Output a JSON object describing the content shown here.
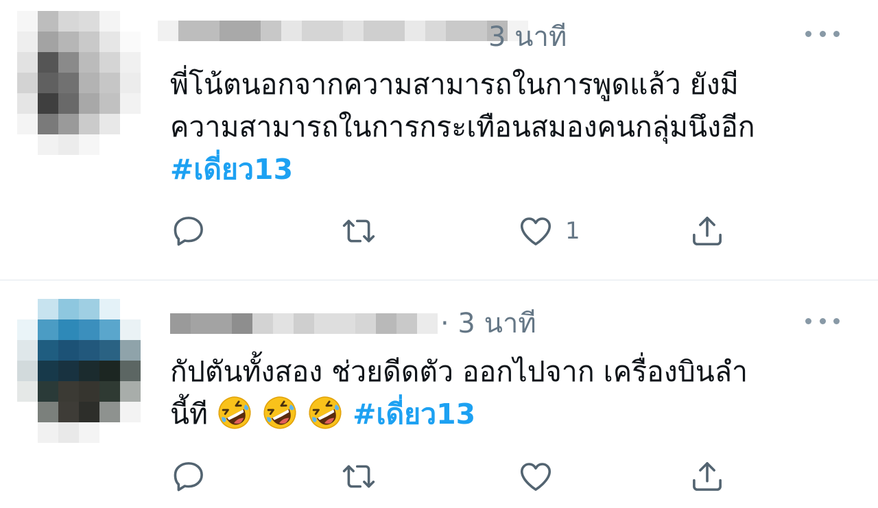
{
  "tweets": [
    {
      "time": "3 นาที",
      "lines": [
        "พี่โน้ตนอกจากความสามารถในการพูดแล้ว ยังมี",
        "ความสามารถในการกระเทือนสมองคนกลุ่มนึงอีก"
      ],
      "hashtag": "#เดี่ยว13",
      "emoji_count": 0,
      "like_count": "1"
    },
    {
      "time": "· 3 นาที",
      "lines": [
        "กัปตันทั้งสอง ช่วยดีดตัว ออกไปจาก เครื่องบินลำ",
        "นี้ที"
      ],
      "hashtag": "#เดี่ยว13",
      "emoji_count": 3,
      "like_count": ""
    }
  ],
  "icons": {
    "reply": "reply-icon",
    "retweet": "retweet-icon",
    "like": "heart-icon",
    "share": "share-icon",
    "more": "more-icon",
    "emoji": "rolling-on-floor-laughing-emoji"
  },
  "colors": {
    "hashtag": "#1da1f2",
    "meta": "#657786",
    "icon": "#536471",
    "divider": "#e1e8ed"
  }
}
